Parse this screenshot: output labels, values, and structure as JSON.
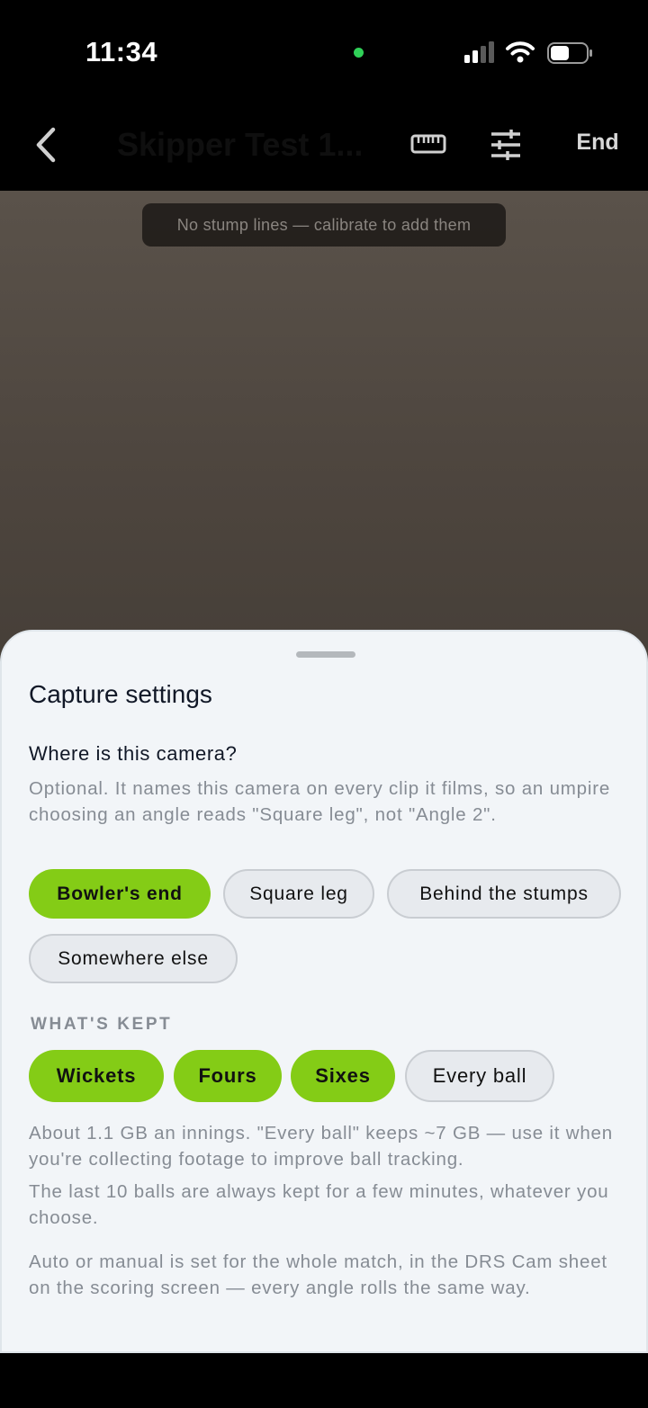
{
  "status_bar": {
    "time": "11:34",
    "dot_color": "#30d158",
    "icons": [
      "cellular-signal-icon",
      "wifi-icon",
      "battery-icon"
    ]
  },
  "nav": {
    "back_icon": "chevron-left-icon",
    "title": "Skipper Test 1...",
    "ruler_icon": "ruler-icon",
    "tune_icon": "sliders-icon",
    "end_label": "End"
  },
  "preview": {
    "toast": "No stump lines — calibrate to add them"
  },
  "sheet": {
    "title": "Capture settings",
    "camera_question": "Where is this camera?",
    "camera_help": "Optional. It names this camera on every clip it films, so an umpire choosing an angle reads \"Square leg\", not \"Angle 2\".",
    "camera_options": [
      {
        "label": "Bowler's end",
        "selected": true
      },
      {
        "label": "Square leg",
        "selected": false
      },
      {
        "label": "Behind the stumps",
        "selected": false
      },
      {
        "label": "Somewhere else",
        "selected": false
      }
    ],
    "kept_label": "WHAT'S KEPT",
    "kept_options": [
      {
        "label": "Wickets",
        "selected": true
      },
      {
        "label": "Fours",
        "selected": true
      },
      {
        "label": "Sixes",
        "selected": true
      },
      {
        "label": "Every ball",
        "selected": false
      }
    ],
    "kept_help_1": "About 1.1 GB an innings. \"Every ball\" keeps ~7 GB — use it when you're collecting footage to improve ball tracking.",
    "kept_help_2": "The last 10 balls are always kept for a few minutes, whatever you choose.",
    "footer_note": "Auto or manual is set for the whole match, in the DRS Cam sheet on the scoring screen — every angle rolls the same way."
  },
  "colors": {
    "accent": "#84cc16",
    "sheet_bg": "#f2f5f8",
    "muted_text": "#868c94"
  }
}
